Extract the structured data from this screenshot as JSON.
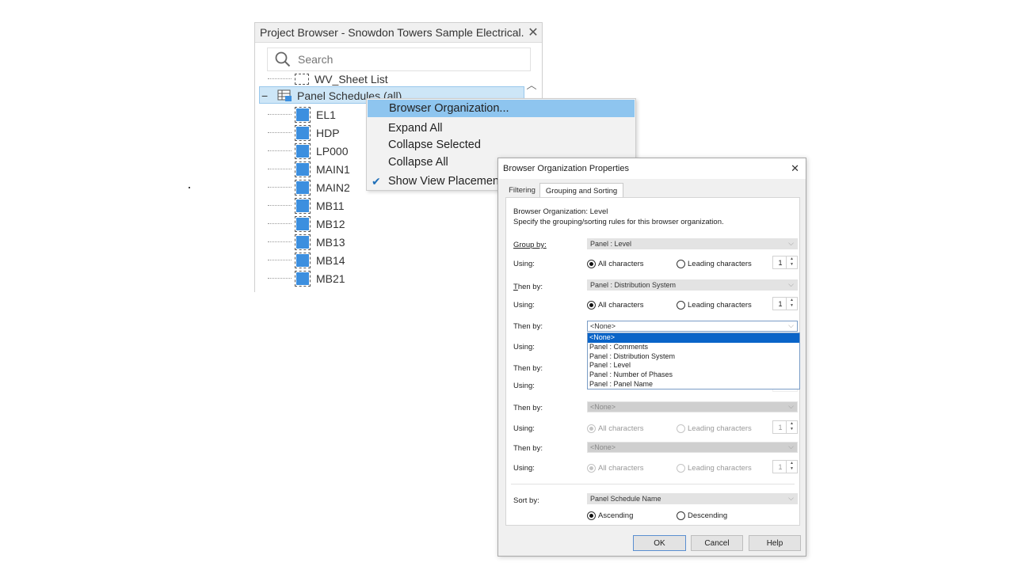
{
  "project_browser": {
    "title": "Project Browser - Snowdon Towers Sample Electrical...",
    "close": "✕",
    "search_placeholder": "Search",
    "partial_item": "WV_Sheet List",
    "group": {
      "toggle": "−",
      "label": "Panel Schedules (all)"
    },
    "items": [
      "EL1",
      "HDP",
      "LP000",
      "MAIN1",
      "MAIN2",
      "MB11",
      "MB12",
      "MB13",
      "MB14",
      "MB21"
    ]
  },
  "context_menu": {
    "items": [
      "Browser Organization...",
      "Expand All",
      "Collapse Selected",
      "Collapse All",
      "Show View Placement"
    ],
    "highlighted_index": 0,
    "checked_item": "Show View Placement"
  },
  "dialog": {
    "title": "Browser Organization Properties",
    "close": "✕",
    "tabs": [
      "Filtering",
      "Grouping and Sorting"
    ],
    "active_tab": "Grouping and Sorting",
    "org_line": "Browser Organization: Level",
    "desc_line": "Specify the grouping/sorting rules for this browser organization.",
    "group_by_label": "Group by:",
    "then_by_label": "Then by:",
    "using_label": "Using:",
    "all_chars": "All characters",
    "leading_chars": "Leading characters",
    "spin_value": "1",
    "rules": [
      {
        "value": "Panel : Level"
      },
      {
        "value": "Panel : Distribution System"
      },
      {
        "value": "<None>"
      },
      {
        "value": ""
      },
      {
        "value": "<None>"
      },
      {
        "value": "<None>"
      }
    ],
    "dropdown_options": [
      "<None>",
      "Panel : Comments",
      "Panel : Distribution System",
      "Panel : Level",
      "Panel : Number of Phases",
      "Panel : Panel Name"
    ],
    "dropdown_selected": "<None>",
    "sort_by_label": "Sort by:",
    "sort_by_value": "Panel Schedule Name",
    "ascending": "Ascending",
    "descending": "Descending",
    "buttons": {
      "ok": "OK",
      "cancel": "Cancel",
      "help": "Help"
    },
    "colors": {
      "accent": "#0a64c8",
      "menu_highlight": "#8ec5ef",
      "view_icon": "#3c8fdf"
    }
  }
}
